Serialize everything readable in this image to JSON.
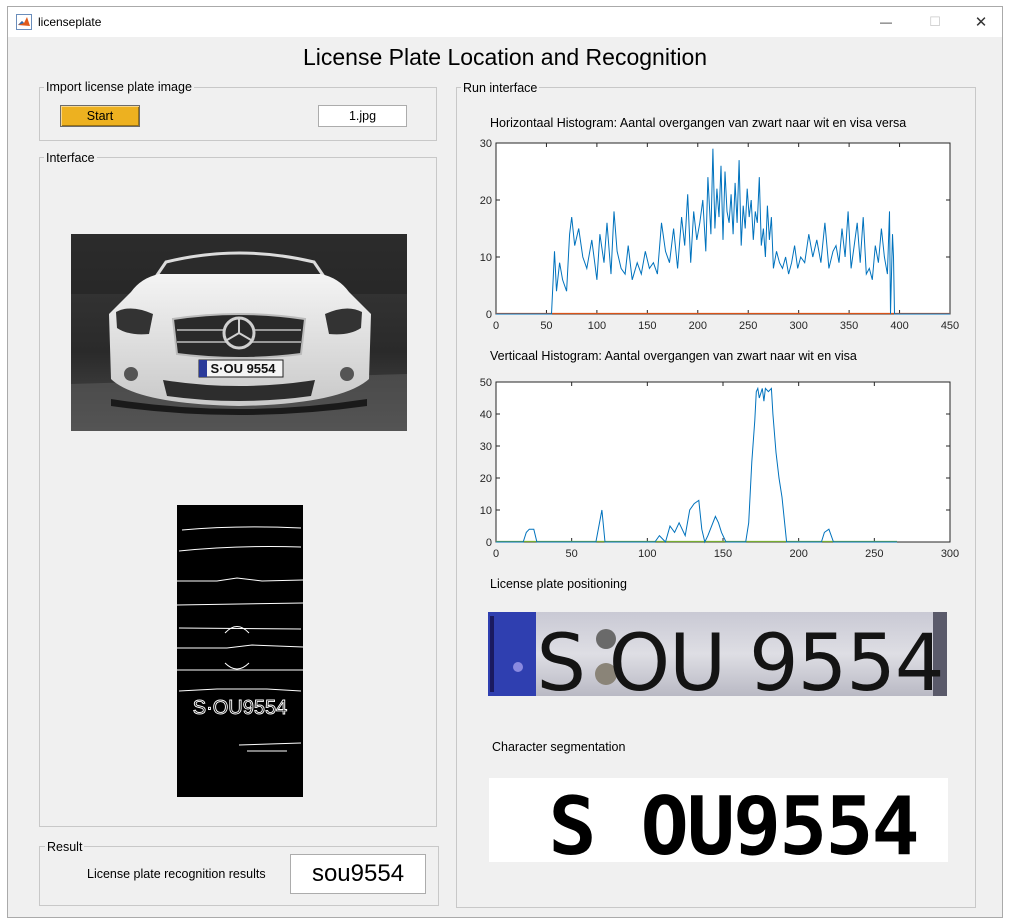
{
  "window": {
    "title": "licenseplate",
    "app_icon": "matlab-icon",
    "controls": [
      "minimize-icon",
      "maximize-icon",
      "close-icon"
    ],
    "minimize_glyph": "—",
    "maximize_glyph": "☐",
    "close_glyph": "✕"
  },
  "app_title": "License Plate Location and Recognition",
  "import_panel": {
    "title": "Import license plate image",
    "start_label": "Start",
    "file_name": "1.jpg",
    "start_color": "#edb120"
  },
  "interface_panel": {
    "title": "Interface",
    "images": [
      {
        "content": "front view of white Mercedes car with license plate",
        "plate_text": "S·OU 9554"
      },
      {
        "content": "edge-detected binary image of car front",
        "plate_text": "S·OU9554"
      }
    ]
  },
  "result_panel": {
    "title": "Result",
    "label": "License plate recognition results",
    "value": "sou9554"
  },
  "run_panel": {
    "title": "Run interface",
    "plate_title": "License plate positioning",
    "plate_text": "S OU 9554",
    "segmentation_title": "Character segmentation",
    "segmentation_text": "S OU9554"
  },
  "chart_data": [
    {
      "type": "line",
      "title": "Horizontaal Histogram: Aantal overgangen van zwart naar wit en visa versa",
      "xlim": [
        0,
        450
      ],
      "ylim": [
        0,
        30
      ],
      "xticks": [
        0,
        50,
        100,
        150,
        200,
        250,
        300,
        350,
        400,
        450
      ],
      "yticks": [
        0,
        10,
        20,
        30
      ],
      "grid": false,
      "line_color": "#0072bd",
      "baseline_color": "#d95319",
      "x": [
        0,
        55,
        58,
        60,
        63,
        66,
        70,
        73,
        75,
        78,
        82,
        86,
        90,
        95,
        100,
        103,
        107,
        110,
        114,
        117,
        120,
        124,
        128,
        131,
        135,
        140,
        144,
        148,
        152,
        156,
        160,
        164,
        168,
        172,
        176,
        180,
        184,
        187,
        190,
        193,
        196,
        199,
        202,
        205,
        208,
        210,
        213,
        215,
        217,
        219,
        221,
        223,
        225,
        227,
        229,
        231,
        233,
        235,
        237,
        239,
        241,
        243,
        245,
        247,
        249,
        251,
        253,
        255,
        257,
        259,
        261,
        263,
        265,
        267,
        269,
        271,
        273,
        275,
        278,
        281,
        284,
        287,
        290,
        293,
        296,
        299,
        302,
        306,
        310,
        314,
        318,
        322,
        326,
        330,
        334,
        337,
        340,
        343,
        346,
        349,
        352,
        355,
        358,
        361,
        364,
        367,
        370,
        373,
        376,
        379,
        382,
        385,
        388,
        390,
        391,
        393,
        394,
        395,
        450
      ],
      "y": [
        0,
        0,
        11,
        4,
        9,
        6,
        4,
        14,
        17,
        12,
        15,
        10,
        8,
        13,
        6,
        14,
        9,
        16,
        7,
        18,
        11,
        8,
        7,
        12,
        6,
        9,
        7,
        11,
        8,
        9,
        7,
        16,
        11,
        9,
        15,
        8,
        17,
        12,
        21,
        9,
        18,
        13,
        16,
        20,
        11,
        24,
        14,
        29,
        15,
        22,
        17,
        26,
        13,
        25,
        18,
        16,
        21,
        14,
        23,
        16,
        27,
        12,
        19,
        15,
        22,
        17,
        20,
        13,
        18,
        16,
        24,
        12,
        15,
        10,
        19,
        13,
        17,
        8,
        11,
        9,
        8,
        10,
        7,
        9,
        12,
        8,
        10,
        9,
        14,
        10,
        13,
        9,
        16,
        8,
        11,
        12,
        9,
        15,
        10,
        18,
        8,
        12,
        16,
        9,
        17,
        7,
        8,
        6,
        12,
        9,
        15,
        10,
        7,
        18,
        0,
        14,
        10,
        0,
        0
      ]
    },
    {
      "type": "line",
      "title": "Verticaal Histogram: Aantal overgangen van zwart naar wit en visa",
      "xlim": [
        0,
        300
      ],
      "ylim": [
        0,
        50
      ],
      "xticks": [
        0,
        50,
        100,
        150,
        200,
        250,
        300
      ],
      "yticks": [
        0,
        10,
        20,
        30,
        40,
        50
      ],
      "grid": false,
      "line_color": "#0072bd",
      "baseline_color": "#77ac30",
      "x": [
        0,
        18,
        20,
        22,
        25,
        27,
        66,
        68,
        70,
        72,
        105,
        108,
        112,
        115,
        118,
        121,
        125,
        128,
        131,
        134,
        136,
        138,
        140,
        145,
        147,
        149,
        152,
        155,
        165,
        167,
        169,
        171,
        172,
        173,
        174,
        176,
        177,
        178,
        180,
        182,
        183,
        185,
        187,
        189,
        192,
        195,
        215,
        217,
        220,
        223,
        265
      ],
      "y": [
        0,
        0,
        3,
        4,
        4,
        0,
        0,
        5,
        10,
        0,
        0,
        2,
        0,
        5,
        3,
        6,
        2,
        10,
        12,
        13,
        4,
        0,
        2,
        8,
        6,
        3,
        0,
        0,
        0,
        6,
        25,
        38,
        47,
        48,
        45,
        48,
        44,
        48,
        47,
        48,
        40,
        28,
        20,
        14,
        0,
        0,
        0,
        3,
        4,
        0,
        0
      ]
    }
  ]
}
